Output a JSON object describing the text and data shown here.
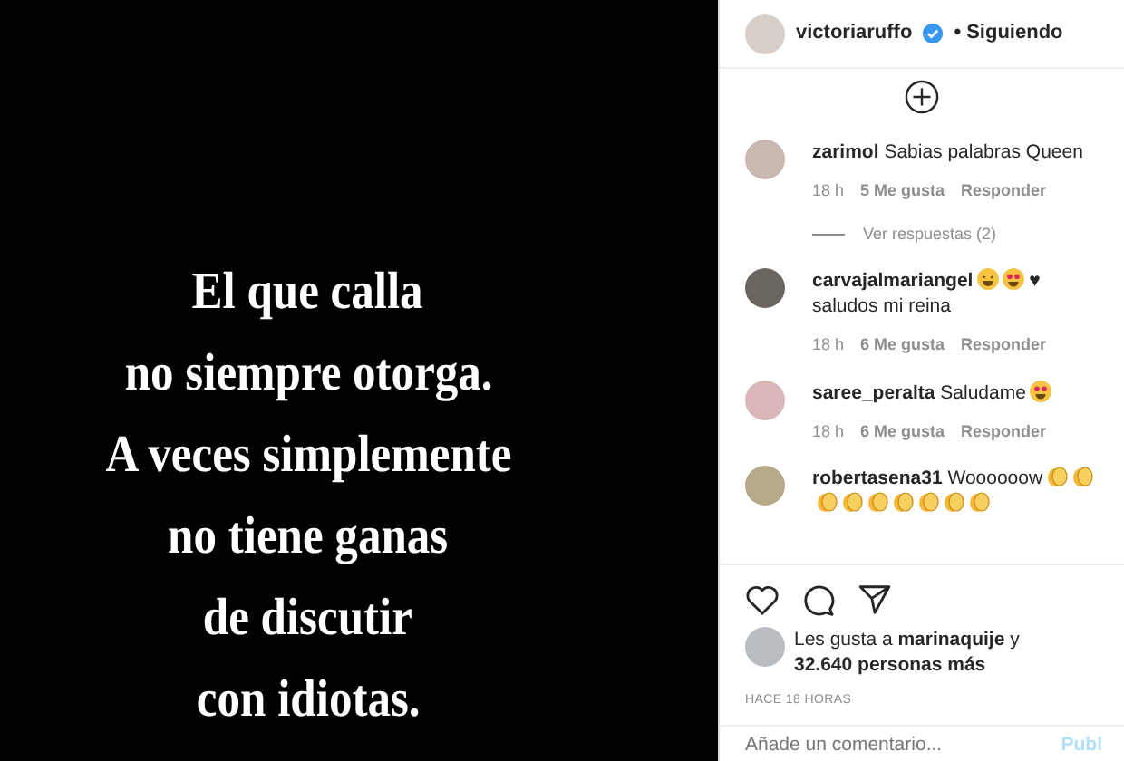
{
  "post_image": {
    "lines": [
      "El que calla",
      "no siempre otorga.",
      "A veces simplemente",
      "no tiene ganas",
      "de discutir",
      "con idiotas."
    ]
  },
  "header": {
    "username": "victoriaruffo",
    "verified": true,
    "follow_status": "• Siguiendo"
  },
  "comments": [
    {
      "user": "zarimol",
      "parts": [
        {
          "kind": "text",
          "text": "Sabias palabras Queen"
        }
      ],
      "time": "18 h",
      "likes": "5 Me gusta",
      "reply": "Responder",
      "replies_link": "Ver respuestas (2)"
    },
    {
      "user": "carvajalmariangel",
      "parts": [
        {
          "kind": "grin"
        },
        {
          "kind": "heart_eyes"
        },
        {
          "kind": "text",
          "text": "♥"
        },
        {
          "kind": "break"
        },
        {
          "kind": "text",
          "text": "saludos mi reina"
        }
      ],
      "time": "18 h",
      "likes": "6 Me gusta",
      "reply": "Responder"
    },
    {
      "user": "saree_peralta",
      "parts": [
        {
          "kind": "text",
          "text": "Saludame"
        },
        {
          "kind": "heart_eyes"
        }
      ],
      "time": "18 h",
      "likes": "6 Me gusta",
      "reply": "Responder"
    },
    {
      "user": "robertasena31",
      "parts": [
        {
          "kind": "text",
          "text": "Woooooow"
        },
        {
          "kind": "clap"
        },
        {
          "kind": "clap"
        },
        {
          "kind": "break"
        },
        {
          "kind": "clap"
        },
        {
          "kind": "clap"
        },
        {
          "kind": "clap"
        },
        {
          "kind": "clap"
        },
        {
          "kind": "clap"
        },
        {
          "kind": "clap"
        },
        {
          "kind": "clap"
        }
      ]
    }
  ],
  "likes": {
    "prefix": "Les gusta a ",
    "user": "marinaquije",
    "suffix": " y",
    "others": "32.640 personas más"
  },
  "timestamp": "HACE 18 HORAS",
  "comment_box": {
    "placeholder": "Añade un comentario...",
    "button": "Publ"
  }
}
